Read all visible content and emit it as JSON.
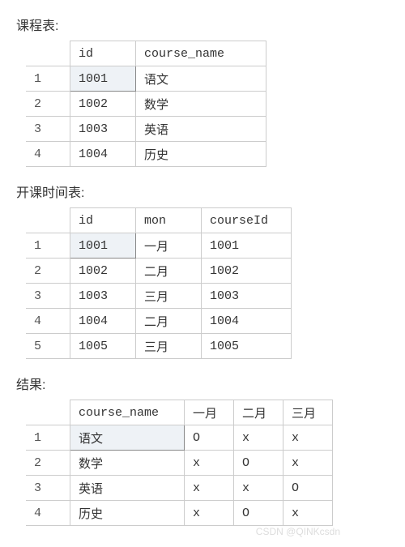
{
  "sections": {
    "courses_title": "课程表:",
    "schedule_title": "开课时间表:",
    "result_title": "结果:"
  },
  "courses": {
    "headers": {
      "id": "id",
      "course_name": "course_name"
    },
    "rows": [
      {
        "n": "1",
        "id": "1001",
        "course_name": "语文"
      },
      {
        "n": "2",
        "id": "1002",
        "course_name": "数学"
      },
      {
        "n": "3",
        "id": "1003",
        "course_name": "英语"
      },
      {
        "n": "4",
        "id": "1004",
        "course_name": "历史"
      }
    ]
  },
  "schedule": {
    "headers": {
      "id": "id",
      "mon": "mon",
      "courseId": "courseId"
    },
    "rows": [
      {
        "n": "1",
        "id": "1001",
        "mon": "一月",
        "courseId": "1001"
      },
      {
        "n": "2",
        "id": "1002",
        "mon": "二月",
        "courseId": "1002"
      },
      {
        "n": "3",
        "id": "1003",
        "mon": "三月",
        "courseId": "1003"
      },
      {
        "n": "4",
        "id": "1004",
        "mon": "二月",
        "courseId": "1004"
      },
      {
        "n": "5",
        "id": "1005",
        "mon": "三月",
        "courseId": "1005"
      }
    ]
  },
  "result": {
    "headers": {
      "course_name": "course_name",
      "m1": "一月",
      "m2": "二月",
      "m3": "三月"
    },
    "rows": [
      {
        "n": "1",
        "course_name": "语文",
        "m1": "O",
        "m2": "x",
        "m3": "x"
      },
      {
        "n": "2",
        "course_name": "数学",
        "m1": "x",
        "m2": "O",
        "m3": "x"
      },
      {
        "n": "3",
        "course_name": "英语",
        "m1": "x",
        "m2": "x",
        "m3": "O"
      },
      {
        "n": "4",
        "course_name": "历史",
        "m1": "x",
        "m2": "O",
        "m3": "x"
      }
    ]
  },
  "watermark": "CSDN @QINKcsdn"
}
